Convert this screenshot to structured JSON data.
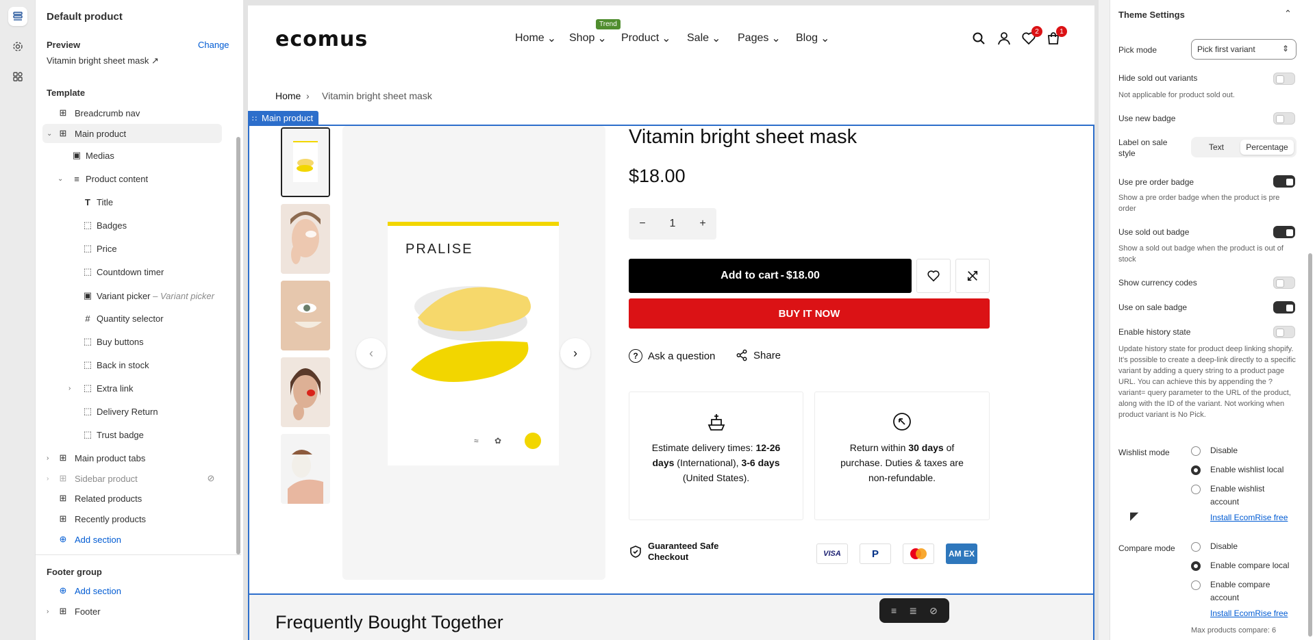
{
  "left_panel": {
    "title": "Default product",
    "preview_label": "Preview",
    "change_label": "Change",
    "preview_value": "Vitamin bright sheet mask",
    "template_label": "Template",
    "items": [
      {
        "label": "Breadcrumb nav"
      },
      {
        "label": "Main product"
      },
      {
        "label": "Medias"
      },
      {
        "label": "Product content"
      },
      {
        "label": "Title"
      },
      {
        "label": "Badges"
      },
      {
        "label": "Price"
      },
      {
        "label": "Countdown timer"
      },
      {
        "label": "Variant picker",
        "sub": "Variant picker"
      },
      {
        "label": "Quantity selector"
      },
      {
        "label": "Buy buttons"
      },
      {
        "label": "Back in stock"
      },
      {
        "label": "Extra link"
      },
      {
        "label": "Delivery Return"
      },
      {
        "label": "Trust badge"
      },
      {
        "label": "Main product tabs"
      },
      {
        "label": "Sidebar product"
      },
      {
        "label": "Related products"
      },
      {
        "label": "Recently products"
      }
    ],
    "add_section": "Add section",
    "footer_group": "Footer group",
    "footer_add_section": "Add section",
    "footer_item": "Footer"
  },
  "store": {
    "logo": "ecomus",
    "nav": [
      "Home",
      "Shop",
      "Product",
      "Sale",
      "Pages",
      "Blog"
    ],
    "trend_badge": "Trend",
    "wishlist_count": "2",
    "cart_count": "1",
    "breadcrumb": [
      "Home",
      "Vitamin bright sheet mask"
    ],
    "section_tag": "Main product",
    "product_brand_on_image": "PRALISE",
    "product_title": "Vitamin bright sheet mask",
    "price": "$18.00",
    "quantity": "1",
    "add_to_cart": "Add to cart",
    "add_to_cart_price": "$18.00",
    "buy_now": "BUY IT NOW",
    "ask_question": "Ask a question",
    "share": "Share",
    "delivery": {
      "p1": "Estimate delivery times: ",
      "b1": "12-26 days",
      "p2": " (International), ",
      "b2": "3-6 days",
      "p3": " (United States)."
    },
    "returns": {
      "p1": "Return within ",
      "b1": "30 days",
      "p2": " of purchase. Duties & taxes are non-refundable."
    },
    "safe_checkout": "Guaranteed Safe Checkout",
    "cards": [
      "VISA",
      "PayPal",
      "Mastercard",
      "AMEX"
    ],
    "next_section_title": "Frequently Bought Together"
  },
  "settings": {
    "header": "Theme Settings",
    "pick_mode_label": "Pick mode",
    "pick_mode_value": "Pick first variant",
    "hide_sold_out": {
      "label": "Hide sold out variants",
      "help": "Not applicable for product sold out.",
      "on": false
    },
    "use_new_badge": {
      "label": "Use new badge",
      "on": false
    },
    "label_on_sale": {
      "label": "Label on sale style",
      "options": [
        "Text",
        "Percentage"
      ],
      "selected": "Percentage"
    },
    "pre_order": {
      "label": "Use pre order badge",
      "help": "Show a pre order badge when the product is pre order",
      "on": true
    },
    "sold_out_badge": {
      "label": "Use sold out badge",
      "help": "Show a sold out badge when the product is out of stock",
      "on": true
    },
    "currency_codes": {
      "label": "Show currency codes",
      "on": false
    },
    "on_sale_badge": {
      "label": "Use on sale badge",
      "on": true
    },
    "history_state": {
      "label": "Enable history state",
      "help": "Update history state for product deep linking shopify. It's possible to create a deep-link directly to a specific variant by adding a query string to a product page URL. You can achieve this by appending the ?variant= query parameter to the URL of the product, along with the ID of the variant. Not working when product variant is No Pick.",
      "on": false
    },
    "wishlist": {
      "label": "Wishlist mode",
      "options": [
        "Disable",
        "Enable wishlist local",
        "Enable wishlist account"
      ],
      "selected": "Enable wishlist local",
      "link": "Install EcomRise free"
    },
    "compare": {
      "label": "Compare mode",
      "options": [
        "Disable",
        "Enable compare local",
        "Enable compare account"
      ],
      "selected": "Enable compare local",
      "link": "Install EcomRise free"
    },
    "max_compare": "Max products compare: 6"
  }
}
